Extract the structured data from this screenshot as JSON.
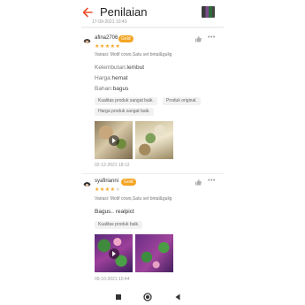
{
  "header": {
    "title": "Penilaian",
    "previous_review_date": "17-09-2021 10:40"
  },
  "reviews": [
    {
      "username": "afina2706",
      "badge": "Gold",
      "rating": 5,
      "variant": "Variasi: Motif cowo,Satu set bntal&gulig",
      "attributes": [
        {
          "key": "Kelembutan:",
          "value": "lembut"
        },
        {
          "key": "Harga:",
          "value": "hemat"
        },
        {
          "key": "Bahan:",
          "value": "bagus"
        }
      ],
      "tags": [
        "Kualitas produk sangat baik.",
        "Produk original.",
        "Harga produk sangat baik."
      ],
      "date": "02-12-2021 18:12"
    },
    {
      "username": "syafirianni",
      "badge": "Gold",
      "rating": 4,
      "variant": "Variasi: Motif cowo,Satu set bntal&gulig",
      "comment": "Bagus.. realpict",
      "tags": [
        "Kualitas produk baik."
      ],
      "date": "09-10-2021 10:44"
    }
  ],
  "icons": {
    "back": "arrow-left-icon",
    "like": "thumbs-up-icon",
    "more": "more-icon",
    "play": "play-icon",
    "nav": [
      "square-icon",
      "circle-icon",
      "triangle-back-icon"
    ]
  },
  "colors": {
    "accent": "#ee4d2d",
    "badge": "#f4a524",
    "star": "#f5a623"
  }
}
